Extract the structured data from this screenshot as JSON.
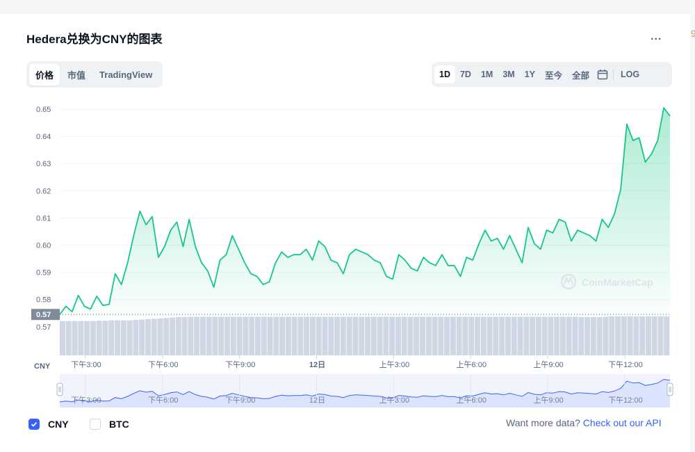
{
  "title": "Hedera兑换为CNY的图表",
  "more_label": "...",
  "view_tabs": [
    {
      "label": "价格",
      "active": true
    },
    {
      "label": "市值",
      "active": false
    },
    {
      "label": "TradingView",
      "active": false
    }
  ],
  "ranges": [
    {
      "label": "1D",
      "active": true
    },
    {
      "label": "7D",
      "active": false
    },
    {
      "label": "1M",
      "active": false
    },
    {
      "label": "3M",
      "active": false
    },
    {
      "label": "1Y",
      "active": false
    },
    {
      "label": "至今",
      "active": false
    },
    {
      "label": "全部",
      "active": false
    }
  ],
  "calendar_icon": "calendar-icon",
  "log_label": "LOG",
  "watermark": "CoinMarketCap",
  "legend": {
    "cny_label": "CNY",
    "cny_checked": true,
    "btc_label": "BTC",
    "btc_checked": false
  },
  "api_note": {
    "text": "Want more data?",
    "link": "Check out our API"
  },
  "colors": {
    "line": "#16c784",
    "volume": "#cfd6e4",
    "navigator_line": "#3861fb",
    "navigator_fill": "#dce4fd",
    "accent": "#3861fb"
  },
  "chart_data": {
    "type": "area",
    "currency": "CNY",
    "ylim": [
      0.565,
      0.652
    ],
    "yticks": [
      "0.65",
      "0.64",
      "0.63",
      "0.62",
      "0.61",
      "0.60",
      "0.59",
      "0.58",
      "0.57"
    ],
    "y_reference_label": "0.57",
    "y_reference_value": 0.5745,
    "xticks": [
      "下午3:00",
      "下午6:00",
      "下午9:00",
      "12日",
      "上午3:00",
      "上午6:00",
      "上午9:00",
      "下午12:00"
    ],
    "xtick_hours": [
      1,
      4,
      7,
      10,
      13,
      16,
      19,
      22
    ],
    "x_hours": [
      0,
      0.24,
      0.48,
      0.72,
      0.96,
      1.2,
      1.44,
      1.68,
      1.92,
      2.16,
      2.4,
      2.64,
      2.88,
      3.12,
      3.36,
      3.6,
      3.84,
      4.08,
      4.32,
      4.56,
      4.8,
      5.04,
      5.28,
      5.52,
      5.76,
      6.0,
      6.24,
      6.48,
      6.72,
      6.96,
      7.2,
      7.44,
      7.68,
      7.92,
      8.16,
      8.4,
      8.64,
      8.88,
      9.12,
      9.36,
      9.6,
      9.84,
      10.08,
      10.32,
      10.56,
      10.8,
      11.04,
      11.28,
      11.52,
      11.76,
      12.0,
      12.24,
      12.48,
      12.72,
      12.96,
      13.2,
      13.44,
      13.68,
      13.92,
      14.16,
      14.4,
      14.64,
      14.88,
      15.12,
      15.36,
      15.6,
      15.84,
      16.08,
      16.32,
      16.56,
      16.8,
      17.04,
      17.28,
      17.52,
      17.76,
      18.0,
      18.24,
      18.48,
      18.72,
      18.96,
      19.2,
      19.44,
      19.68,
      19.92,
      20.16,
      20.4,
      20.64,
      20.88,
      21.12,
      21.36,
      21.6,
      21.84,
      22.08,
      22.32,
      22.56,
      22.8,
      23.04,
      23.28,
      23.52,
      23.76
    ],
    "prices": [
      0.5745,
      0.5775,
      0.5755,
      0.5815,
      0.5775,
      0.5765,
      0.5812,
      0.5778,
      0.5782,
      0.5895,
      0.5855,
      0.5935,
      0.6035,
      0.6125,
      0.6075,
      0.6105,
      0.5955,
      0.5995,
      0.6055,
      0.6085,
      0.5995,
      0.6095,
      0.5995,
      0.5935,
      0.5905,
      0.5845,
      0.5945,
      0.5965,
      0.6035,
      0.5985,
      0.5935,
      0.5895,
      0.5885,
      0.5855,
      0.5865,
      0.5935,
      0.5975,
      0.5955,
      0.5965,
      0.5965,
      0.5985,
      0.5945,
      0.6015,
      0.5995,
      0.5945,
      0.5935,
      0.5895,
      0.5965,
      0.5985,
      0.5975,
      0.5965,
      0.5945,
      0.5935,
      0.5885,
      0.5875,
      0.5965,
      0.5945,
      0.5915,
      0.5905,
      0.5955,
      0.5935,
      0.5925,
      0.5965,
      0.5925,
      0.5925,
      0.5885,
      0.5955,
      0.5945,
      0.6005,
      0.6055,
      0.6015,
      0.6025,
      0.5985,
      0.6035,
      0.5985,
      0.5935,
      0.6065,
      0.6005,
      0.5985,
      0.6055,
      0.6045,
      0.6095,
      0.6085,
      0.6015,
      0.6055,
      0.6045,
      0.6035,
      0.6015,
      0.6095,
      0.6065,
      0.6115,
      0.6205,
      0.6445,
      0.6385,
      0.6395,
      0.6305,
      0.6335,
      0.6385,
      0.6505,
      0.6475
    ],
    "volumes": [
      0.88,
      0.88,
      0.88,
      0.88,
      0.88,
      0.88,
      0.89,
      0.89,
      0.9,
      0.9,
      0.9,
      0.9,
      0.91,
      0.92,
      0.93,
      0.94,
      0.95,
      0.96,
      0.97,
      0.98,
      0.98,
      0.99,
      0.99,
      0.99,
      0.99,
      0.99,
      0.99,
      0.99,
      0.99,
      0.99,
      0.99,
      0.99,
      0.99,
      0.99,
      0.99,
      0.99,
      0.99,
      0.99,
      0.99,
      0.99,
      0.99,
      0.99,
      0.99,
      0.99,
      0.99,
      0.99,
      0.99,
      0.99,
      0.99,
      0.99,
      0.99,
      0.99,
      0.99,
      0.99,
      0.99,
      0.99,
      0.99,
      0.99,
      0.99,
      0.99,
      0.99,
      0.99,
      0.99,
      0.99,
      0.99,
      0.99,
      0.99,
      0.99,
      0.99,
      0.99,
      0.99,
      0.99,
      0.99,
      0.99,
      0.99,
      0.99,
      0.99,
      0.99,
      0.99,
      0.99,
      0.99,
      0.99,
      0.99,
      0.99,
      0.99,
      0.98,
      0.98,
      0.98,
      0.98,
      0.99,
      1.0,
      1.0,
      1.0,
      1.0,
      1.0,
      1.0,
      1.0,
      1.0,
      1.0,
      1.0
    ],
    "grid": true
  }
}
